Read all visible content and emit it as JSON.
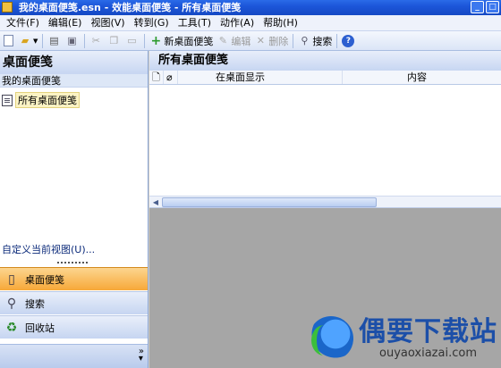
{
  "window": {
    "title": "我的桌面便笺.esn - 效能桌面便笺 - 所有桌面便笺",
    "buttons": [
      "_",
      "□"
    ]
  },
  "menubar": {
    "items": [
      "文件(F)",
      "编辑(E)",
      "视图(V)",
      "转到(G)",
      "工具(T)",
      "动作(A)",
      "帮助(H)"
    ]
  },
  "toolbar": {
    "new_note_label": "新桌面便笺",
    "edit_label": "编辑",
    "delete_label": "删除",
    "search_label": "搜索"
  },
  "left_panel": {
    "header": "桌面便笺",
    "subheader": "我的桌面便笺",
    "tree_item": "所有桌面便笺",
    "customize_view": "自定义当前视图(U)...",
    "nav": {
      "notes": "桌面便笺",
      "search": "搜索",
      "recycle": "回收站"
    }
  },
  "right_panel": {
    "header": "所有桌面便笺",
    "columns": [
      "",
      "",
      "在桌面显示",
      "内容"
    ]
  },
  "watermark": {
    "name": "偶要下载站",
    "url": "ouyaoxiazai.com"
  }
}
